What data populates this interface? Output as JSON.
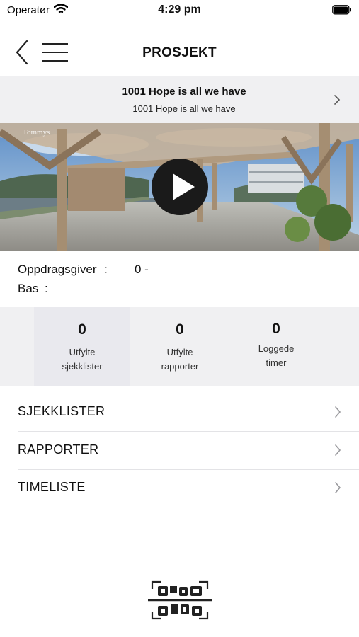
{
  "status_bar": {
    "carrier": "Operatør",
    "time": "4:29 pm"
  },
  "nav": {
    "title": "PROSJEKT"
  },
  "project": {
    "title": "1001 Hope is all we have",
    "subtitle": "1001 Hope is all we have"
  },
  "video": {
    "watermark": "Tommys"
  },
  "info": {
    "client_label": "Oppdragsgiver",
    "client_sep": ":",
    "client_value": "0 -",
    "boss_label": "Bas",
    "boss_sep": ":"
  },
  "stats": [
    {
      "value": "0",
      "label_line1": "Utfylte",
      "label_line2": "sjekklister"
    },
    {
      "value": "0",
      "label_line1": "Utfylte",
      "label_line2": "rapporter"
    },
    {
      "value": "0",
      "label_line1": "Loggede",
      "label_line2": "timer"
    }
  ],
  "menu": [
    {
      "label": "SJEKKLISTER"
    },
    {
      "label": "RAPPORTER"
    },
    {
      "label": "TIMELISTE"
    }
  ],
  "icons": {
    "wifi": "wifi-icon",
    "battery": "battery-icon",
    "back": "chevron-left-icon",
    "menu": "hamburger-menu-icon",
    "play": "play-icon",
    "chevron": "chevron-right-icon",
    "qr": "qr-code-icon"
  },
  "colors": {
    "header_bg": "#f0f0f2",
    "text": "#111111",
    "play_button": "#1a1a1a"
  }
}
